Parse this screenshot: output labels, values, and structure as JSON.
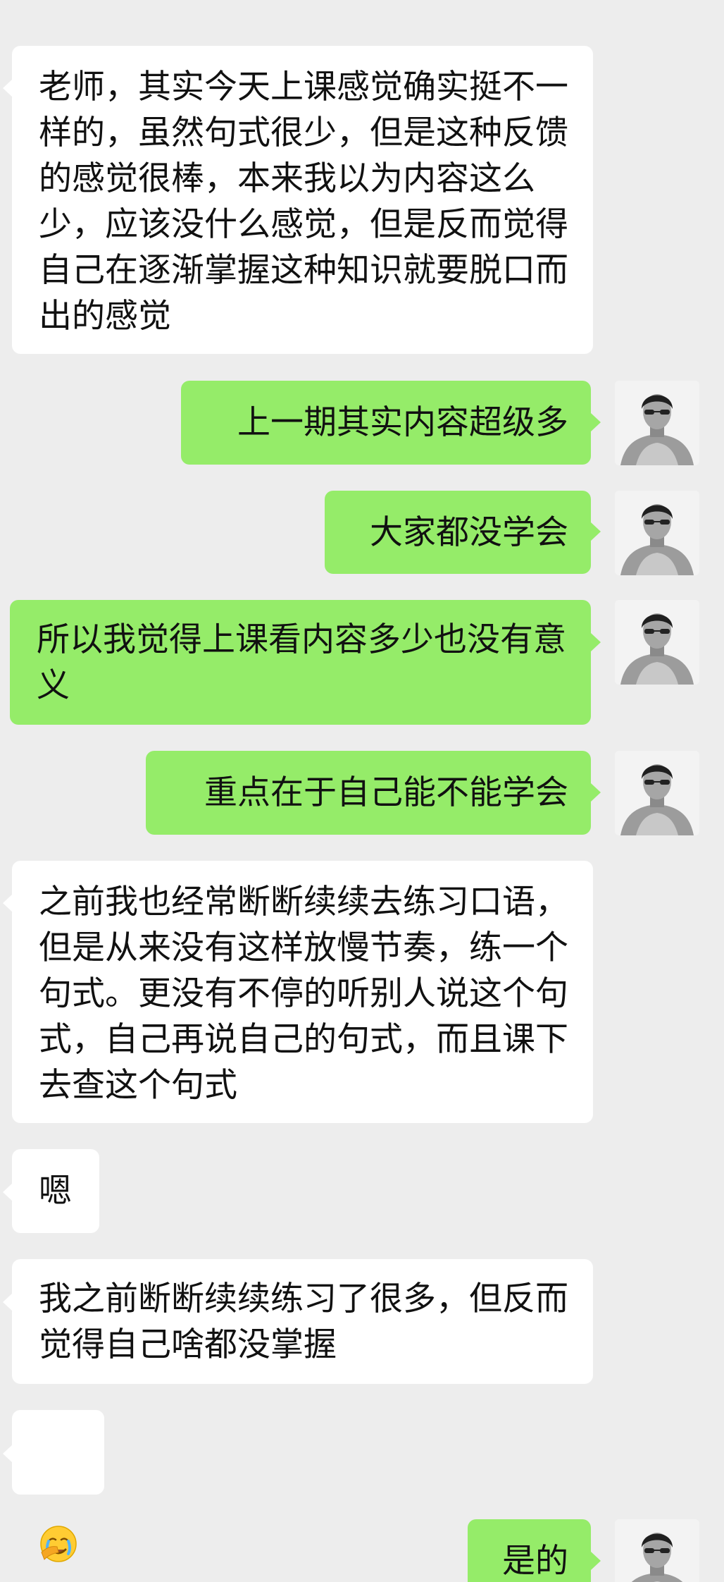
{
  "conversation": {
    "messages": [
      {
        "side": "left",
        "text": "老师，其实今天上课感觉确实挺不一样的，虽然句式很少，但是这种反馈的感觉很棒，本来我以为内容这么少，应该没什么感觉，但是反而觉得自己在逐渐掌握这种知识就要脱口而出的感觉"
      },
      {
        "side": "right",
        "text": "上一期其实内容超级多"
      },
      {
        "side": "right",
        "text": "大家都没学会"
      },
      {
        "side": "right",
        "text": "所以我觉得上课看内容多少也没有意义"
      },
      {
        "side": "right",
        "text": "重点在于自己能不能学会"
      },
      {
        "side": "left",
        "text": "之前我也经常断断续续去练习口语，但是从来没有这样放慢节奏，练一个句式。更没有不停的听别人说这个句式，自己再说自己的句式，而且课下去查这个句式"
      },
      {
        "side": "left",
        "text": "嗯"
      },
      {
        "side": "left",
        "text": "我之前断断续续练习了很多，但反而觉得自己啥都没掌握"
      },
      {
        "side": "left",
        "emoji": "facepalm-crying-emoji"
      },
      {
        "side": "right",
        "text": "是的"
      }
    ],
    "colors": {
      "background": "#ededed",
      "incoming_bubble": "#ffffff",
      "outgoing_bubble": "#95ec69"
    }
  }
}
